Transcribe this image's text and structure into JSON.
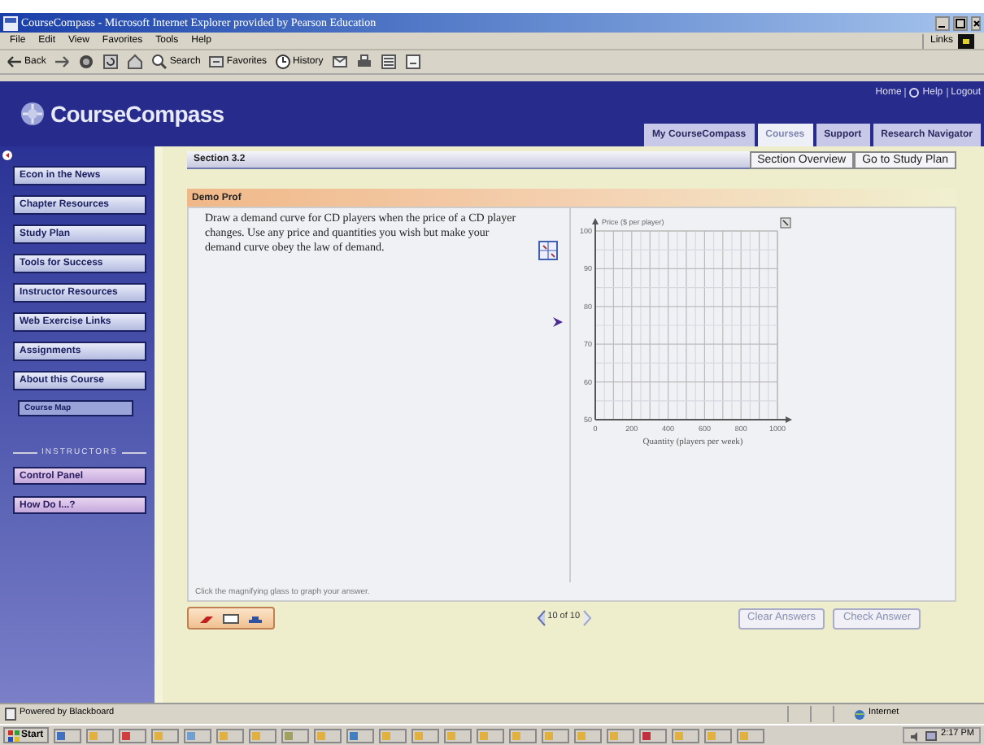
{
  "window": {
    "title": "CourseCompass - Microsoft Internet Explorer provided by Pearson Education"
  },
  "menu": [
    "File",
    "Edit",
    "View",
    "Favorites",
    "Tools",
    "Help"
  ],
  "links_label": "Links",
  "toolbar": [
    {
      "kind": "back",
      "label": "Back"
    },
    {
      "kind": "forward"
    },
    {
      "kind": "stop"
    },
    {
      "kind": "refresh"
    },
    {
      "kind": "home"
    },
    {
      "kind": "search",
      "label": "Search"
    },
    {
      "kind": "favorites",
      "label": "Favorites"
    },
    {
      "kind": "history",
      "label": "History"
    },
    {
      "kind": "mail"
    },
    {
      "kind": "print"
    },
    {
      "kind": "edit"
    },
    {
      "kind": "discuss"
    }
  ],
  "header": {
    "logo": "CourseCompass",
    "top_links": [
      "Home",
      "Help",
      "Logout"
    ],
    "tabs": [
      {
        "label": "My CourseCompass",
        "selected": false
      },
      {
        "label": "Courses",
        "selected": true
      },
      {
        "label": "Support",
        "selected": false
      },
      {
        "label": "Research Navigator",
        "selected": false
      }
    ]
  },
  "sidebar": {
    "items": [
      {
        "label": "Econ in the News",
        "kind": "main"
      },
      {
        "label": "Chapter Resources",
        "kind": "main"
      },
      {
        "label": "Study Plan",
        "kind": "main"
      },
      {
        "label": "Tools for Success",
        "kind": "main"
      },
      {
        "label": "Instructor Resources",
        "kind": "main"
      },
      {
        "label": "Web Exercise Links",
        "kind": "main"
      },
      {
        "label": "Assignments",
        "kind": "main"
      },
      {
        "label": "About this Course",
        "kind": "main"
      },
      {
        "label": "Course Map",
        "kind": "sub"
      }
    ],
    "section_label": "INSTRUCTORS",
    "instructor_items": [
      "Control Panel",
      "How Do I...?"
    ]
  },
  "section": {
    "title": "Section 3.2",
    "buttons": [
      "Section Overview",
      "Go to Study Plan"
    ]
  },
  "exercise": {
    "author": "Demo Prof",
    "question": "Draw a demand curve for CD players when the price of a CD player changes.  Use any price and quantities you wish but make your demand curve obey the law of demand.",
    "chart_data": {
      "type": "line",
      "ylabel": "Price ($ per player)",
      "xlabel": "Quantity (players per week)",
      "xlim": [
        0,
        1000
      ],
      "ylim": [
        50,
        100
      ],
      "xticks": [
        0,
        200,
        400,
        600,
        800,
        1000
      ],
      "yticks": [
        50,
        60,
        70,
        80,
        90,
        100
      ],
      "grid": true
    },
    "hint": "Click the magnifying glass to graph your answer.",
    "pager": "10 of 10",
    "buttons": [
      {
        "label": "Clear Answers",
        "disabled": true
      },
      {
        "label": "Check Answer",
        "disabled": true
      }
    ]
  },
  "status_bar": {
    "text": "Powered by Blackboard",
    "zone": "Internet"
  },
  "taskbar": {
    "start": "Start",
    "clock": "2:17 PM"
  }
}
